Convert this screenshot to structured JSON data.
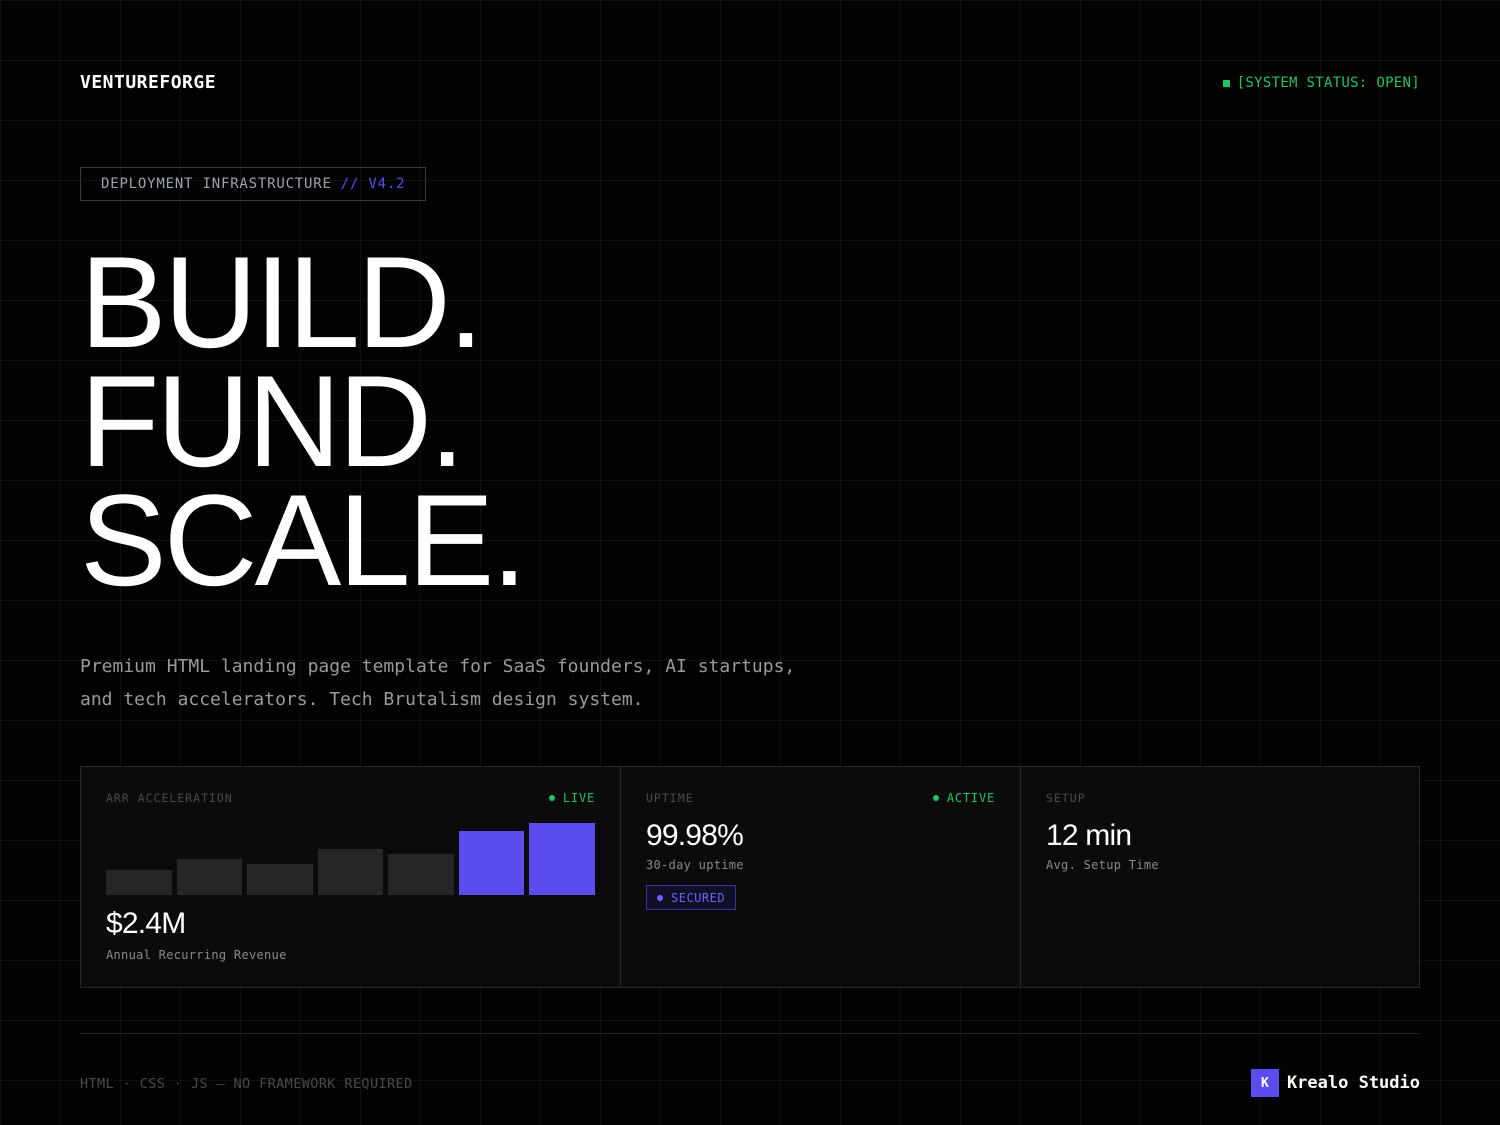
{
  "header": {
    "brand": "VENTUREFORGE",
    "status": "[SYSTEM STATUS: OPEN]"
  },
  "hero": {
    "tag_label": "DEPLOYMENT INFRASTRUCTURE",
    "tag_version": "// V4.2",
    "lines": [
      "BUILD.",
      "FUND.",
      "SCALE."
    ],
    "description_lines": [
      "Premium HTML landing page template for SaaS founders, AI startups,",
      "and tech accelerators. Tech Brutalism design system."
    ]
  },
  "stats": {
    "arr": {
      "label": "ARR ACCELERATION",
      "badge": "LIVE",
      "value": "$2.4M",
      "caption": "Annual Recurring Revenue"
    },
    "uptime": {
      "label": "UPTIME",
      "badge": "ACTIVE",
      "value": "99.98%",
      "caption": "30-day uptime",
      "tag": "SECURED"
    },
    "setup": {
      "label": "SETUP",
      "value": "12 min",
      "caption": "Avg. Setup Time"
    }
  },
  "chart_data": {
    "type": "bar",
    "values": [
      35,
      50,
      43,
      64,
      57,
      89,
      100
    ],
    "highlighted": [
      false,
      false,
      false,
      false,
      false,
      true,
      true
    ],
    "ylim": [
      0,
      100
    ]
  },
  "footer": {
    "stack": "HTML · CSS · JS — NO FRAMEWORK REQUIRED",
    "credit_initial": "K",
    "credit_name": "Krealo Studio"
  },
  "colors": {
    "background": "#020202",
    "accent": "#5b4cf0",
    "status_green": "#22c55e",
    "bar_muted": "#262626",
    "card_background": "#0b0b0b"
  }
}
